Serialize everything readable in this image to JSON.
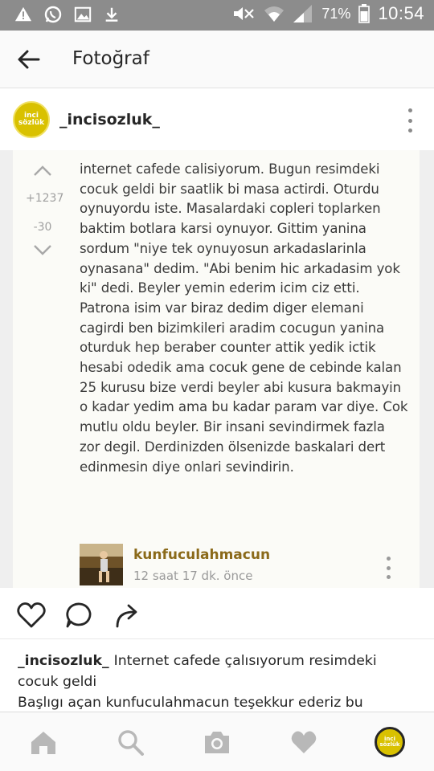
{
  "status_bar": {
    "battery_percent": "71%",
    "time": "10:54"
  },
  "app_bar": {
    "title": "Fotoğraf"
  },
  "post": {
    "username": "_incisozluk_",
    "avatar_text_top": "inci",
    "avatar_text_bottom": "sözlük"
  },
  "entry": {
    "upvotes": "+1237",
    "downvotes": "-30",
    "text": "internet cafede calisiyorum. Bugun resimdeki cocuk geldi bir saatlik bi masa actirdi. Oturdu oynuyordu iste. Masalardaki copleri toplarken baktim botlara karsi oynuyor. Gittim yanina sordum \"niye tek oynuyosun arkadaslarinla oynasana\" dedim. \"Abi benim hic arkadasim yok ki\" dedi. Beyler yemin ederim icim ciz etti. Patrona isim var biraz dedim diger elemani cagirdi ben bizimkileri aradim cocugun yanina oturduk hep beraber counter attik yedik ictik hesabi odedik ama cocuk gene de cebinde kalan 25 kurusu bize verdi beyler abi kusura bakmayin o kadar yedim ama bu kadar param var diye. Cok mutlu oldu beyler. Bir insani sevindirmek fazla zor degil. Derdinizden ölsenizde baskalari dert edinmesin diye onlari sevindirin.",
    "author": "kunfuculahmacun",
    "time_ago": "12 saat 17 dk. önce"
  },
  "caption": {
    "username": "_incisozluk_",
    "line1": "Internet cafede çalısıyorum resimdeki cocuk geldi",
    "line2": "Başlıgı açan kunfuculahmacun teşekkur ederiz bu"
  },
  "colors": {
    "status_bar_bg": "#8c8c8c",
    "brand_yellow": "#d9c100",
    "author_name": "#8b6a1a"
  },
  "icons": {
    "status_left": [
      "warning-icon",
      "whatsapp-icon",
      "image-icon",
      "download-icon"
    ],
    "status_right": [
      "mute-icon",
      "wifi-icon",
      "signal-icon",
      "battery-icon"
    ],
    "actions": [
      "heart-icon",
      "comment-icon",
      "share-icon"
    ],
    "nav": [
      "home-icon",
      "search-icon",
      "camera-icon",
      "activity-heart-icon",
      "profile-avatar"
    ]
  }
}
